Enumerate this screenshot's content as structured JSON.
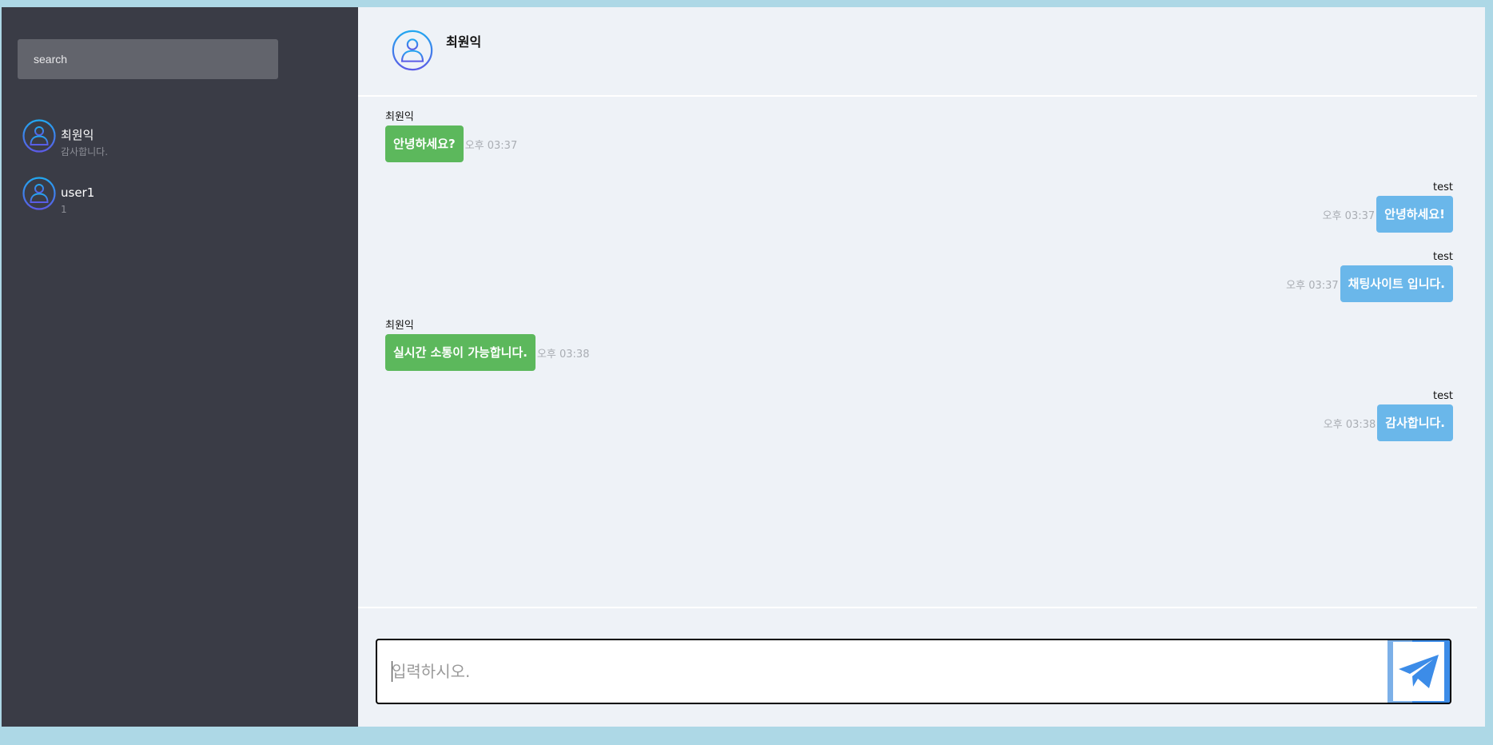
{
  "sidebar": {
    "search": {
      "placeholder": "search"
    },
    "friends": [
      {
        "name": "최원익",
        "last_message": "감사합니다."
      },
      {
        "name": "user1",
        "last_message": "1"
      }
    ]
  },
  "chat": {
    "header": {
      "title": "최원익"
    },
    "messages": [
      {
        "side": "left",
        "sender": "최원익",
        "text": "안녕하세요?",
        "time": "오후 03:37"
      },
      {
        "side": "right",
        "sender": "test",
        "text": "안녕하세요!",
        "time": "오후 03:37"
      },
      {
        "side": "right",
        "sender": "test",
        "text": "채팅사이트 입니다.",
        "time": "오후 03:37"
      },
      {
        "side": "left",
        "sender": "최원익",
        "text": "실시간 소통이 가능합니다.",
        "time": "오후 03:38"
      },
      {
        "side": "right",
        "sender": "test",
        "text": "감사합니다.",
        "time": "오후 03:38"
      }
    ],
    "input": {
      "placeholder": "입력하시오.",
      "value": ""
    }
  },
  "icons": {
    "avatar": "user-avatar-icon",
    "send": "paper-plane-icon"
  },
  "colors": {
    "sidebar_bg": "#3a3c46",
    "main_bg": "#eef2f7",
    "page_bg": "#add8e6",
    "bubble_left": "#5cb85c",
    "bubble_right": "#6ab7ea",
    "send_button": "#3c8ce8"
  }
}
